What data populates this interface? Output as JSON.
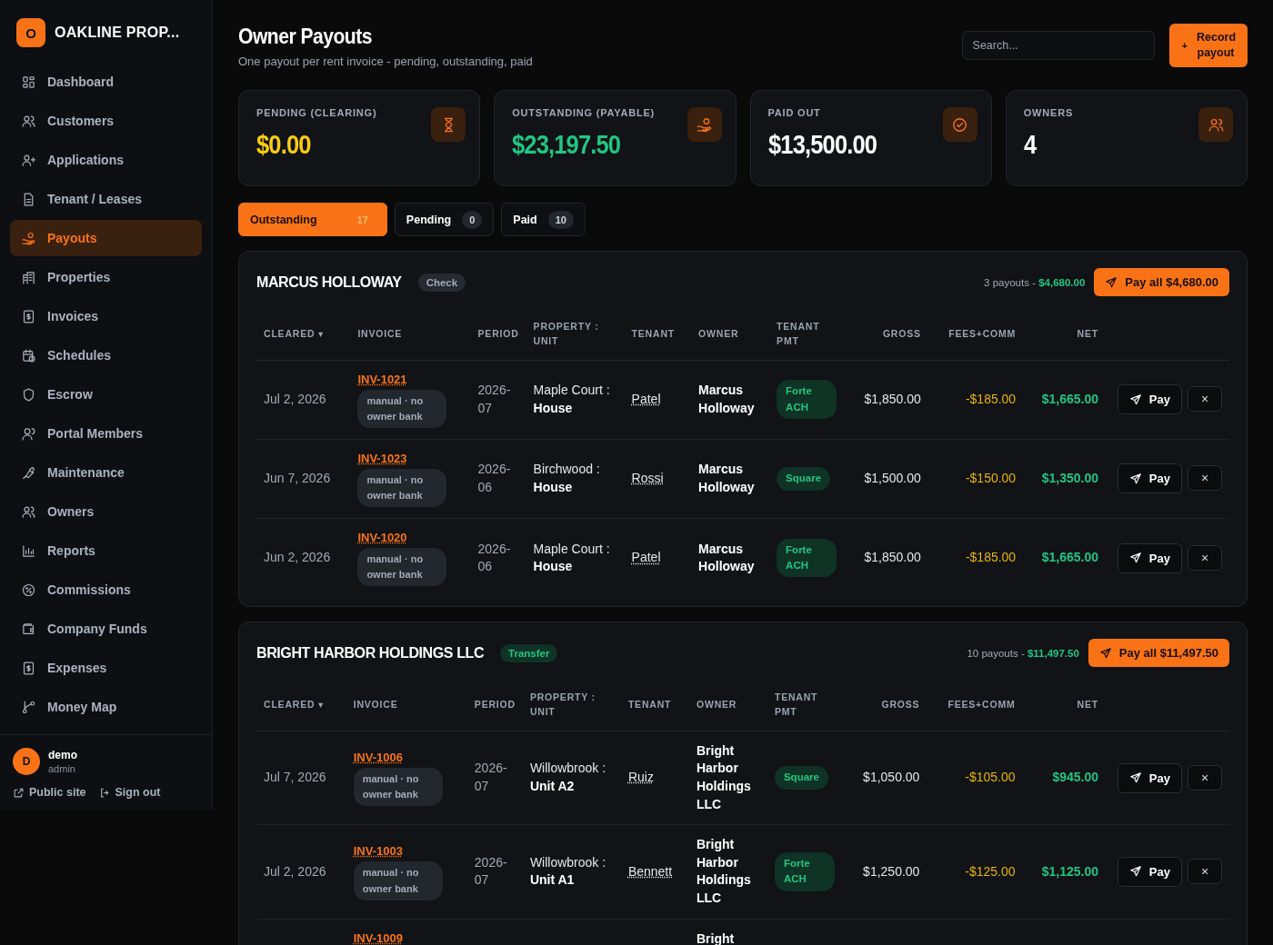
{
  "brand": {
    "initial": "O",
    "name": "OAKLINE PROP..."
  },
  "sidebar": {
    "items": [
      {
        "label": "Dashboard",
        "selected": false
      },
      {
        "label": "Customers",
        "selected": false
      },
      {
        "label": "Applications",
        "selected": false
      },
      {
        "label": "Tenant / Leases",
        "selected": false
      },
      {
        "label": "Payouts",
        "selected": true
      },
      {
        "label": "Properties",
        "selected": false
      },
      {
        "label": "Invoices",
        "selected": false
      },
      {
        "label": "Schedules",
        "selected": false
      },
      {
        "label": "Escrow",
        "selected": false
      },
      {
        "label": "Portal Members",
        "selected": false
      },
      {
        "label": "Maintenance",
        "selected": false
      },
      {
        "label": "Owners",
        "selected": false
      },
      {
        "label": "Reports",
        "selected": false
      },
      {
        "label": "Commissions",
        "selected": false
      },
      {
        "label": "Company Funds",
        "selected": false
      },
      {
        "label": "Expenses",
        "selected": false
      },
      {
        "label": "Money Map",
        "selected": false
      }
    ],
    "user": {
      "initial": "D",
      "name": "demo",
      "role": "admin"
    },
    "links": [
      "Public site",
      "Sign out"
    ]
  },
  "header": {
    "title": "Owner Payouts",
    "subtitle": "One payout per rent invoice - pending, outstanding, paid",
    "search": {
      "placeholder": "Search..."
    },
    "record_button": {
      "icon": "+",
      "label": "Record payout"
    }
  },
  "stats": [
    {
      "label": "PENDING (CLEARING)",
      "value": "$0.00",
      "color": "#facc15"
    },
    {
      "label": "OUTSTANDING (PAYABLE)",
      "value": "$23,197.50",
      "color": "#22c583"
    },
    {
      "label": "PAID OUT",
      "value": "$13,500.00",
      "color": "#ffffff"
    },
    {
      "label": "OWNERS",
      "value": "4",
      "color": "#ffffff"
    }
  ],
  "tabs": [
    {
      "label": "Outstanding",
      "count": "17",
      "selected": true
    },
    {
      "label": "Pending",
      "count": "0",
      "selected": false
    },
    {
      "label": "Paid",
      "count": "10",
      "selected": false
    }
  ],
  "groups": [
    {
      "owner": "MARCUS HOLLOWAY",
      "method": {
        "label": "Check",
        "kind": "neutral"
      },
      "summary": "3 payouts -",
      "summary_total": "$4,680.00",
      "pay_all": "Pay all $4,680.00",
      "columns": [
        "CLEARED ▾",
        "INVOICE",
        "PERIOD",
        "PROPERTY : UNIT",
        "TENANT",
        "OWNER",
        "TENANT PMT",
        "GROSS",
        "FEES+COMM",
        "NET"
      ],
      "rows": [
        {
          "cleared": "Jul 2, 2026",
          "invoice": "INV-1021",
          "note": "manual · no owner bank",
          "period": "2026-07",
          "property": "Maple Court :",
          "unit": "House",
          "tenant": "Patel",
          "owner": "Marcus Holloway",
          "pmt": "Forte ACH",
          "gross": "$1,850.00",
          "fees": "-$185.00",
          "net": "$1,665.00",
          "pay": "Pay",
          "close": "×"
        },
        {
          "cleared": "Jun 7, 2026",
          "invoice": "INV-1023",
          "note": "manual · no owner bank",
          "period": "2026-06",
          "property": "Birchwood :",
          "unit": "House",
          "tenant": "Rossi",
          "owner": "Marcus Holloway",
          "pmt": "Square",
          "gross": "$1,500.00",
          "fees": "-$150.00",
          "net": "$1,350.00",
          "pay": "Pay",
          "close": "×"
        },
        {
          "cleared": "Jun 2, 2026",
          "invoice": "INV-1020",
          "note": "manual · no owner bank",
          "period": "2026-06",
          "property": "Maple Court :",
          "unit": "House",
          "tenant": "Patel",
          "owner": "Marcus Holloway",
          "pmt": "Forte ACH",
          "gross": "$1,850.00",
          "fees": "-$185.00",
          "net": "$1,665.00",
          "pay": "Pay",
          "close": "×"
        }
      ]
    },
    {
      "owner": "BRIGHT HARBOR HOLDINGS LLC",
      "method": {
        "label": "Transfer",
        "kind": "positive"
      },
      "summary": "10 payouts -",
      "summary_total": "$11,497.50",
      "pay_all": "Pay all $11,497.50",
      "columns": [
        "CLEARED ▾",
        "INVOICE",
        "PERIOD",
        "PROPERTY : UNIT",
        "TENANT",
        "OWNER",
        "TENANT PMT",
        "GROSS",
        "FEES+COMM",
        "NET"
      ],
      "rows": [
        {
          "cleared": "Jul 7, 2026",
          "invoice": "INV-1006",
          "note": "manual · no owner bank",
          "period": "2026-07",
          "property": "Willowbrook :",
          "unit": "Unit A2",
          "tenant": "Ruiz",
          "owner": "Bright Harbor Holdings LLC",
          "pmt": "Square",
          "gross": "$1,050.00",
          "fees": "-$105.00",
          "net": "$945.00",
          "pay": "Pay",
          "close": "×"
        },
        {
          "cleared": "Jul 2, 2026",
          "invoice": "INV-1003",
          "note": "manual · no owner bank",
          "period": "2026-07",
          "property": "Willowbrook :",
          "unit": "Unit A1",
          "tenant": "Bennett",
          "owner": "Bright Harbor Holdings LLC",
          "pmt": "Forte ACH",
          "gross": "$1,250.00",
          "fees": "-$125.00",
          "net": "$1,125.00",
          "pay": "Pay",
          "close": "×"
        },
        {
          "invoice": "INV-1009",
          "owner": "Bright"
        }
      ]
    }
  ]
}
